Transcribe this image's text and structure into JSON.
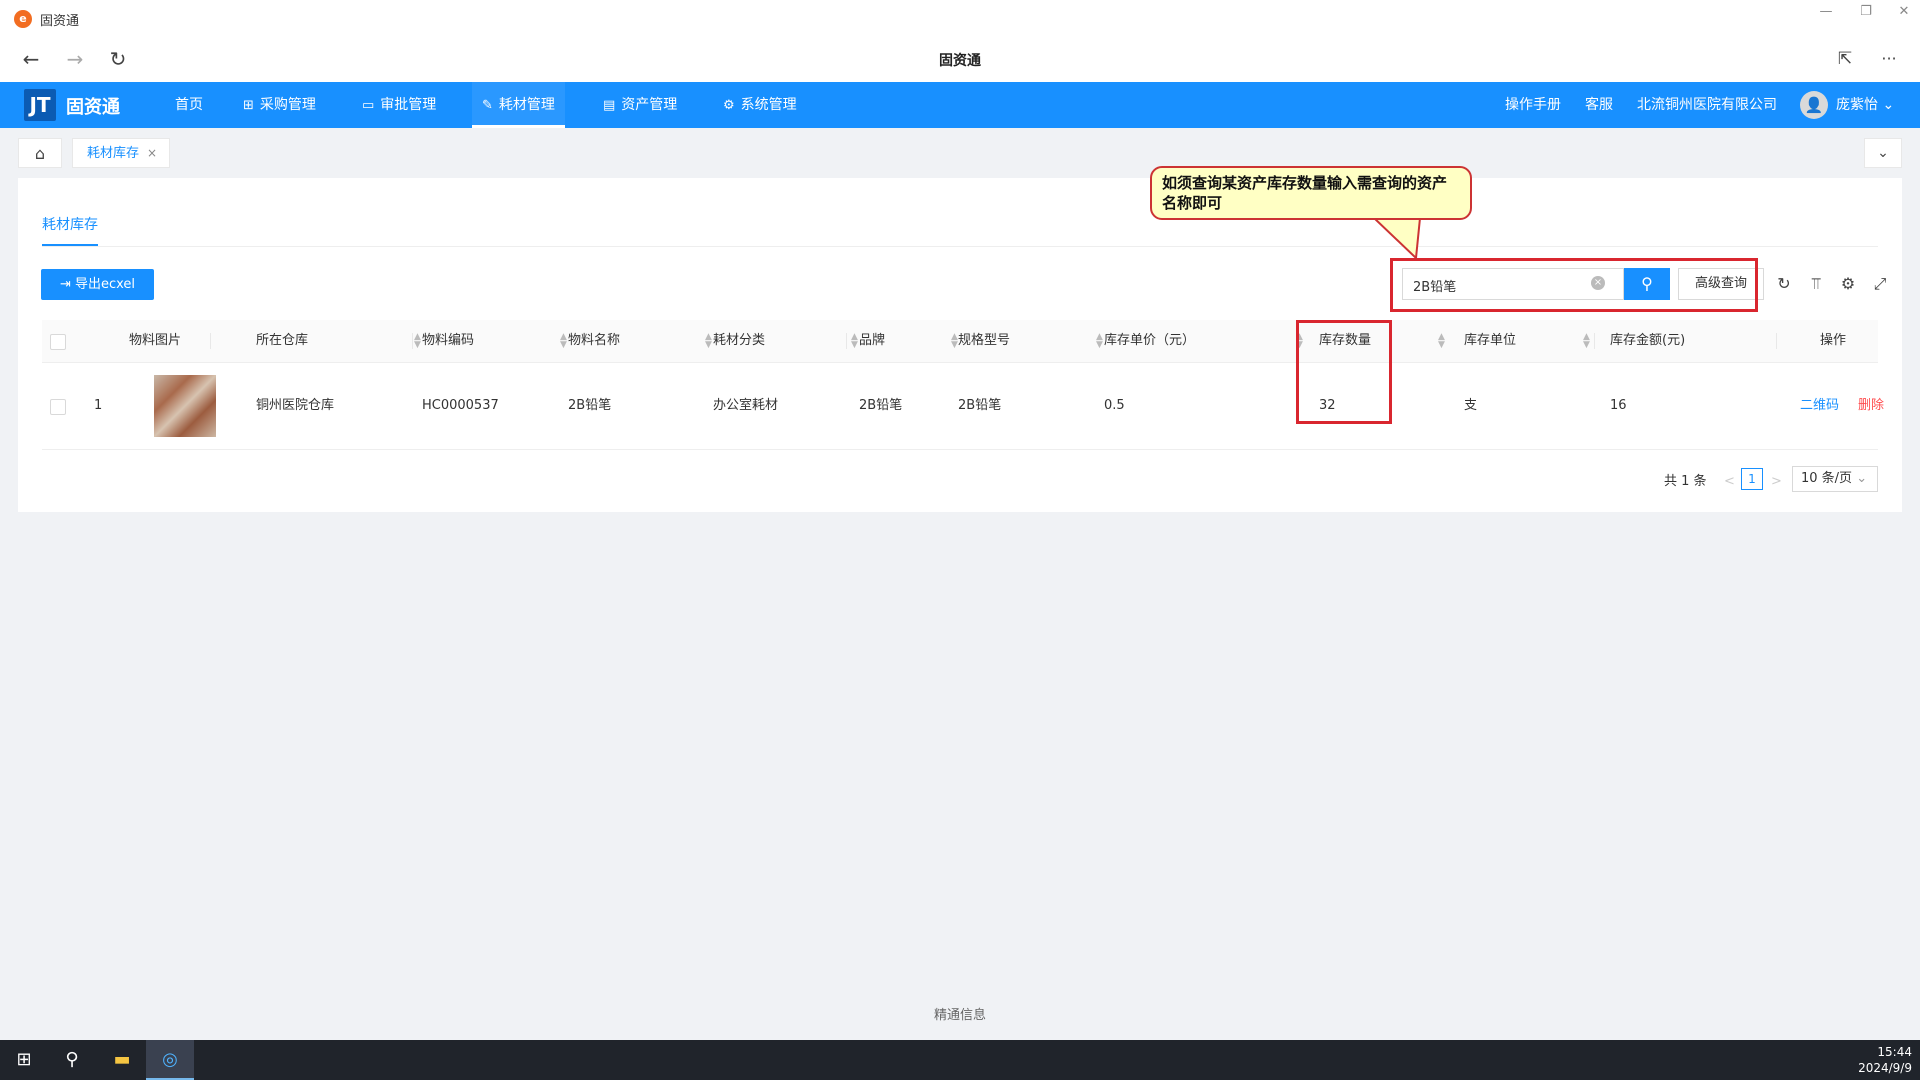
{
  "window": {
    "title": "固资通",
    "min": "—",
    "max": "❐",
    "close": "✕"
  },
  "browser": {
    "page_title": "固资通",
    "back": "←",
    "forward": "→",
    "reload": "↻",
    "share": "⇱",
    "more": "···"
  },
  "header": {
    "brand_icon": "JT",
    "brand_name": "固资通",
    "menu": [
      {
        "label": "首页",
        "icon": ""
      },
      {
        "label": "采购管理",
        "icon": "⊞"
      },
      {
        "label": "审批管理",
        "icon": "▭"
      },
      {
        "label": "耗材管理",
        "icon": "✎"
      },
      {
        "label": "资产管理",
        "icon": "▤"
      },
      {
        "label": "系统管理",
        "icon": "⚙"
      }
    ],
    "active_menu": "耗材管理",
    "manual": "操作手册",
    "service": "客服",
    "company": "北流铜州医院有限公司",
    "user": "庞紫怡",
    "user_caret": "⌄",
    "avatar_icon": "👤"
  },
  "tabs": {
    "home_icon": "⌂",
    "open_tab": "耗材库存",
    "close_icon": "×",
    "dropdown_icon": "⌄"
  },
  "page": {
    "subtab": "耗材库存",
    "export_label": "导出ecxel",
    "export_icon": "⇥",
    "search_value": "2B铅笔",
    "search_clear": "×",
    "search_icon": "⚲",
    "advanced_label": "高级查询",
    "tool_icons": [
      "↻",
      "⫪",
      "⚙",
      "⤢"
    ]
  },
  "table": {
    "columns": [
      "物料图片",
      "所在仓库",
      "物料编码",
      "物料名称",
      "耗材分类",
      "品牌",
      "规格型号",
      "库存单价（元）",
      "库存数量",
      "库存单位",
      "库存金额(元)",
      "操作"
    ],
    "rows": [
      {
        "index": "1",
        "warehouse": "铜州医院仓库",
        "code": "HC0000537",
        "name": "2B铅笔",
        "category": "办公室耗材",
        "brand": "2B铅笔",
        "model": "2B铅笔",
        "unit_price": "0.5",
        "quantity": "32",
        "unit": "支",
        "amount": "16",
        "action_qr": "二维码",
        "action_delete": "删除"
      }
    ]
  },
  "pagination": {
    "total": "共 1 条",
    "prev": "<",
    "current": "1",
    "next": ">",
    "page_size": "10 条/页",
    "page_size_caret": "⌄"
  },
  "annotation": {
    "callout_text": "如须查询某资产库存数量输入需查询的资产名称即可"
  },
  "footer": "精通信息",
  "taskbar": {
    "start_icon": "⊞",
    "search_icon": "⚲",
    "explorer_icon": "▬",
    "browser_icon": "◎",
    "time": "15:44",
    "date": "2024/9/9"
  },
  "colors": {
    "primary": "#1890ff",
    "danger": "#ff4d4f",
    "annotation_red": "#d9262f",
    "callout_bg": "#ffffc4"
  }
}
